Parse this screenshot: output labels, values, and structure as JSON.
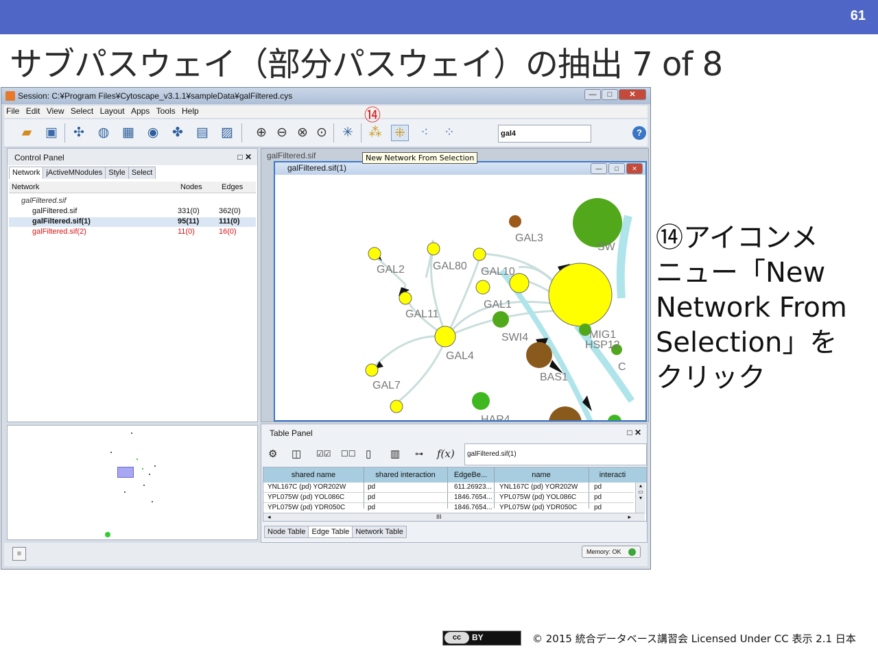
{
  "slide": {
    "page_number": "61",
    "title": "サブパスウェイ（部分パスウェイ）の抽出 7 of 8",
    "caption_lines": [
      "⑭アイコンメ",
      "ニュー「New",
      "Network From",
      "Selection」を",
      "クリック"
    ],
    "marker": "⑭",
    "footer": {
      "cc_label": "cc",
      "by_label": "BY",
      "copyright": "© 2015  統合データベース講習会 Licensed Under CC 表示 2.1 日本"
    }
  },
  "window": {
    "title": "Session: C:¥Program Files¥Cytoscape_v3.1.1¥sampleData¥galFiltered.cys",
    "controls": [
      "—",
      "□",
      "✕"
    ],
    "menu": [
      "File",
      "Edit",
      "View",
      "Select",
      "Layout",
      "Apps",
      "Tools",
      "Help"
    ],
    "search_value": "gal4",
    "help_label": "?",
    "tooltip": "New Network From Selection"
  },
  "control_panel": {
    "title": "Control Panel",
    "controls": "□ ✕",
    "tabs": [
      "Network",
      "jActiveMNodules",
      "Style",
      "Select"
    ],
    "columns": [
      "Network",
      "Nodes",
      "Edges"
    ],
    "root": "galFiltered.sif",
    "networks": [
      {
        "name": "galFiltered.sif",
        "nodes": "331(0)",
        "edges": "362(0)"
      },
      {
        "name": "galFiltered.sif(1)",
        "nodes": "95(11)",
        "edges": "111(0)"
      },
      {
        "name": "galFiltered.sif(2)",
        "nodes": "11(0)",
        "edges": "16(0)"
      }
    ]
  },
  "network_view": {
    "bg_title": "galFiltered.sif",
    "inner_title": "galFiltered.sif(1)",
    "inner_controls": [
      "—",
      "□",
      "✕"
    ],
    "labels": {
      "gal3": "GAL3",
      "gal2": "GAL2",
      "gal80": "GAL80",
      "gal10": "GAL10",
      "gal1": "GAL1",
      "gal11": "GAL11",
      "gal4": "GAL4",
      "gal7": "GAL7",
      "swi4": "SWI4",
      "bas1": "BAS1",
      "mig1": "MIG1",
      "hsp12": "HSP12",
      "har4": "HAR4",
      "sw_partial": "SW",
      "c_partial": "C"
    }
  },
  "table_panel": {
    "title": "Table Panel",
    "controls": "□ ✕",
    "table_name": "galFiltered.sif(1)",
    "columns": [
      "shared name",
      "shared interaction",
      "EdgeBe...",
      "name",
      "interacti"
    ],
    "rows": [
      [
        "YNL167C (pd) YOR202W",
        "pd",
        "611.26923...",
        "YNL167C (pd) YOR202W",
        "pd"
      ],
      [
        "YPL075W (pd) YOL086C",
        "pd",
        "1846.7654...",
        "YPL075W (pd) YOL086C",
        "pd"
      ],
      [
        "YPL075W (pd) YDR050C",
        "pd",
        "1846.7654...",
        "YPL075W (pd) YDR050C",
        "pd"
      ]
    ],
    "scroll_mark": "III",
    "tabs": [
      "Node Table",
      "Edge Table",
      "Network Table"
    ],
    "fx": "f(x)"
  },
  "status": {
    "memory": "Memory: OK"
  }
}
